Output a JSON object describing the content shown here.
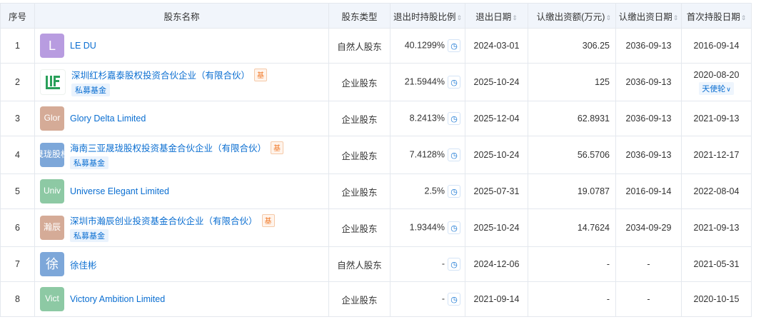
{
  "headers": {
    "index": "序号",
    "name": "股东名称",
    "type": "股东类型",
    "exit_ratio": "退出时持股比例",
    "exit_date": "退出日期",
    "subscribed_amount": "认缴出资额(万元)",
    "subscribed_date": "认缴出资日期",
    "first_hold_date": "首次持股日期"
  },
  "sort_glyph": "⇕",
  "clock_glyph": "◷",
  "chevron_glyph": "∨",
  "fund_tag_glyph": "基",
  "rows": [
    {
      "index": "1",
      "logo_text": "L",
      "logo_color": "#b89ce0",
      "name": "LE DU",
      "type": "自然人股东",
      "exit_ratio": "40.1299%",
      "exit_date": "2024-03-01",
      "amount": "306.25",
      "subscribed_date": "2036-09-13",
      "first_hold_date": "2016-09-14"
    },
    {
      "index": "2",
      "logo_text": "",
      "logo_color": "#ffffff",
      "name": "深圳红杉嘉泰股权投资合伙企业（有限合伙）",
      "fund": true,
      "tag": "私募基金",
      "type": "企业股东",
      "exit_ratio": "21.5944%",
      "exit_date": "2025-10-24",
      "amount": "125",
      "subscribed_date": "2036-09-13",
      "first_hold_date": "2020-08-20",
      "round": "天使轮"
    },
    {
      "index": "3",
      "logo_text": "Glor",
      "logo_color": "#d5ab97",
      "name": "Glory Delta Limited",
      "type": "企业股东",
      "exit_ratio": "8.2413%",
      "exit_date": "2025-12-04",
      "amount": "62.8931",
      "subscribed_date": "2036-09-13",
      "first_hold_date": "2021-09-13"
    },
    {
      "index": "4",
      "logo_text": "晟珑股权",
      "logo_color": "#7da7d9",
      "name": "海南三亚晟珑股权投资基金合伙企业（有限合伙）",
      "fund": true,
      "tag": "私募基金",
      "type": "企业股东",
      "exit_ratio": "7.4128%",
      "exit_date": "2025-10-24",
      "amount": "56.5706",
      "subscribed_date": "2036-09-13",
      "first_hold_date": "2021-12-17"
    },
    {
      "index": "5",
      "logo_text": "Univ",
      "logo_color": "#8dc9a4",
      "name": "Universe Elegant Limited",
      "type": "企业股东",
      "exit_ratio": "2.5%",
      "exit_date": "2025-07-31",
      "amount": "19.0787",
      "subscribed_date": "2016-09-14",
      "first_hold_date": "2022-08-04"
    },
    {
      "index": "6",
      "logo_text": "瀚辰",
      "logo_color": "#d5ab97",
      "name": "深圳市瀚辰创业投资基金合伙企业（有限合伙）",
      "fund": true,
      "tag": "私募基金",
      "type": "企业股东",
      "exit_ratio": "1.9344%",
      "exit_date": "2025-10-24",
      "amount": "14.7624",
      "subscribed_date": "2034-09-29",
      "first_hold_date": "2021-09-13"
    },
    {
      "index": "7",
      "logo_text": "徐",
      "logo_color": "#7da7d9",
      "name": "徐佳彬",
      "type": "自然人股东",
      "exit_ratio": "-",
      "exit_date": "2024-12-06",
      "amount": "-",
      "subscribed_date": "-",
      "first_hold_date": "2021-05-31"
    },
    {
      "index": "8",
      "logo_text": "Vict",
      "logo_color": "#8dc9a4",
      "name": "Victory Ambition Limited",
      "type": "企业股东",
      "exit_ratio": "-",
      "exit_date": "2021-09-14",
      "amount": "-",
      "subscribed_date": "-",
      "first_hold_date": "2020-10-15"
    }
  ],
  "colors": {
    "link": "#0a6ed1",
    "header_bg": "#f1f5fb",
    "border": "#e4e8ee",
    "fund_icon": "#f07a2a"
  }
}
